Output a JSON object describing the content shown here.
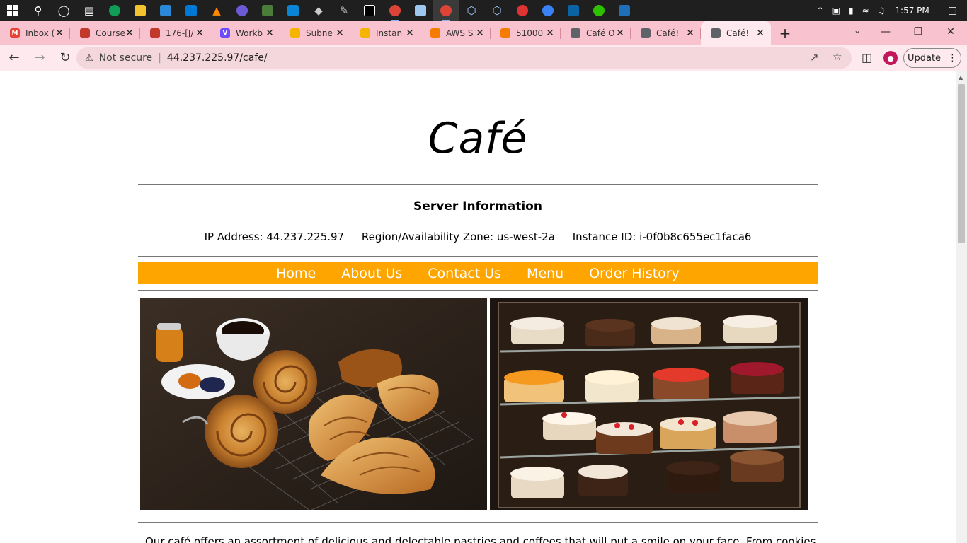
{
  "taskbar": {
    "time": "1:57 PM"
  },
  "tabs": [
    {
      "label": "Inbox (",
      "fav_color": "#ea4335",
      "fav_glyph": "M"
    },
    {
      "label": "Course",
      "fav_color": "#c0392b",
      "fav_glyph": ""
    },
    {
      "label": "176-[J/",
      "fav_color": "#c0392b",
      "fav_glyph": ""
    },
    {
      "label": "Workb",
      "fav_color": "#6c4cff",
      "fav_glyph": "V"
    },
    {
      "label": "Subne",
      "fav_color": "#f4b400",
      "fav_glyph": ""
    },
    {
      "label": "Instan",
      "fav_color": "#f4b400",
      "fav_glyph": ""
    },
    {
      "label": "AWS S",
      "fav_color": "#f57c00",
      "fav_glyph": ""
    },
    {
      "label": "51000",
      "fav_color": "#f57c00",
      "fav_glyph": ""
    },
    {
      "label": "Café O",
      "fav_color": "#5f6368",
      "fav_glyph": ""
    },
    {
      "label": "Café!",
      "fav_color": "#5f6368",
      "fav_glyph": ""
    },
    {
      "label": "Café!",
      "fav_color": "#5f6368",
      "fav_glyph": ""
    }
  ],
  "address": {
    "security": "Not secure",
    "url": "44.237.225.97/cafe/"
  },
  "update_label": "Update",
  "page": {
    "title": "Café",
    "server_heading": "Server Information",
    "ip": "IP Address: 44.237.225.97",
    "region": "Region/Availability Zone: us-west-2a",
    "instance": "Instance ID: i-0f0b8c655ec1faca6",
    "nav": [
      "Home",
      "About Us",
      "Contact Us",
      "Menu",
      "Order History"
    ],
    "description": "Our café offers an assortment of delicious and delectable pastries and coffees that will put a smile on your face. From cookies to"
  },
  "colors": {
    "nav_bar": "#ffa500",
    "tab_strip": "#f9c2cf"
  }
}
